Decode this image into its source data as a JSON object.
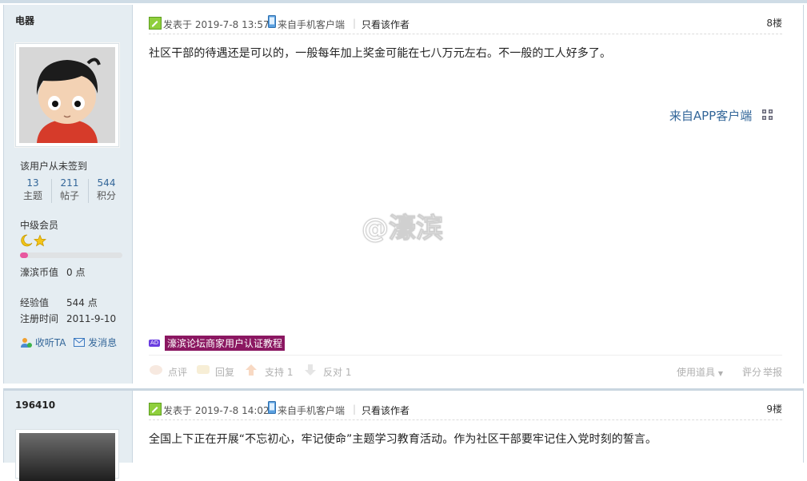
{
  "posts": [
    {
      "author": "电器",
      "sign_status": "该用户从未签到",
      "stats": [
        {
          "num": "13",
          "label": "主题"
        },
        {
          "num": "211",
          "label": "帖子"
        },
        {
          "num": "544",
          "label": "积分"
        }
      ],
      "rank": "中级会员",
      "rank_progress": 0.08,
      "fields": [
        {
          "k": "濠滨币值",
          "v": "0 点"
        },
        {
          "k": "经验值",
          "v": "544 点"
        },
        {
          "k": "注册时间",
          "v": "2011-9-10"
        }
      ],
      "follow": "收听TA",
      "message": "发消息",
      "posted": "发表于 2019-7-8 13:57",
      "client": "来自手机客户端",
      "only_author": "只看该作者",
      "floor": "8楼",
      "content": "社区干部的待遇还是可以的，一般每年加上奖金可能在七八万元左右。不一般的工人好多了。",
      "from_app": "来自APP客户端",
      "watermark": "@濠滨",
      "ad_badge": "AD",
      "ad_text": "濠滨论坛商家用户认证教程",
      "footer": {
        "comment": "点评",
        "reply": "回复",
        "support": "支持",
        "support_count": "1",
        "oppose": "反对",
        "oppose_count": "1",
        "tools": "使用道具",
        "rate": "评分",
        "report": "举报"
      }
    },
    {
      "author": "196410",
      "posted": "发表于 2019-7-8 14:02",
      "client": "来自手机客户端",
      "only_author": "只看该作者",
      "floor": "9楼",
      "content": "全国上下正在开展“不忘初心，牢记使命”主题学习教育活动。作为社区干部要牢记住入党时刻的誓言。"
    }
  ],
  "colors": {
    "link": "#336699",
    "sidebar_bg": "#e5edf2",
    "border": "#c9d6e0",
    "ad_bg": "#8b1761",
    "progress": "#e8579f"
  },
  "icons": [
    "avatar-cartoon",
    "edit-icon",
    "mobile-icon",
    "qr-icon",
    "moon-icon",
    "star-icon",
    "follow-icon",
    "mail-icon",
    "comment-icon",
    "reply-icon",
    "thumb-up-icon",
    "thumb-down-icon"
  ]
}
